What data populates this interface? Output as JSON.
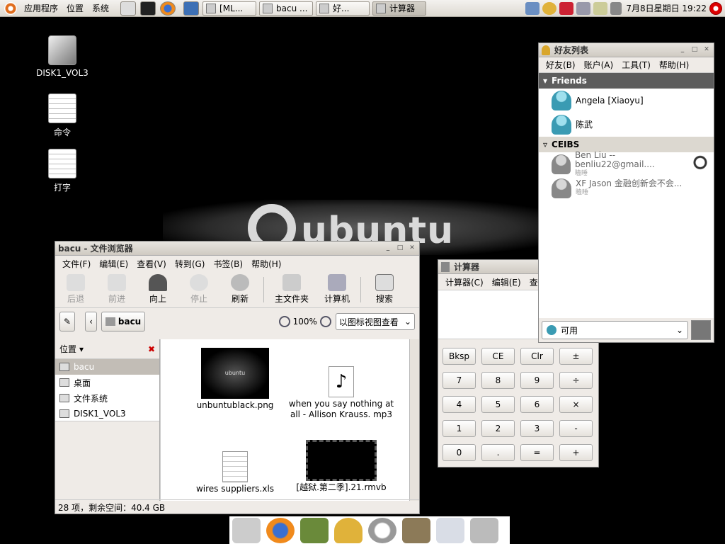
{
  "top_panel": {
    "menus": [
      "应用程序",
      "位置",
      "系统"
    ],
    "tasks": [
      "[ML...",
      "bacu ...",
      "好...",
      "计算器"
    ],
    "clock": "7月8日星期日 19:22"
  },
  "desktop": {
    "logo_text": "ubuntu",
    "icons": [
      "DISK1_VOL3",
      "命令",
      "打字"
    ]
  },
  "file_browser": {
    "title": "bacu - 文件浏览器",
    "menus": [
      "文件(F)",
      "编辑(E)",
      "查看(V)",
      "转到(G)",
      "书签(B)",
      "帮助(H)"
    ],
    "toolbar": [
      "后退",
      "前进",
      "向上",
      "停止",
      "刷新",
      "主文件夹",
      "计算机",
      "搜索"
    ],
    "location": "bacu",
    "zoom": "100%",
    "view_mode": "以图标视图查看",
    "sidebar_header": "位置",
    "places": [
      "bacu",
      "桌面",
      "文件系统",
      "DISK1_VOL3"
    ],
    "files": [
      "unbuntublack.png",
      "when you say nothing at all - Allison Krauss. mp3",
      "wires suppliers.xls",
      "[越狱.第二季].21.rmvb"
    ],
    "thumb_text": "ubuntu",
    "status": "28 项，剩余空间：40.4 GB"
  },
  "calculator": {
    "title": "计算器",
    "menus": [
      "计算器(C)",
      "编辑(E)",
      "查看"
    ],
    "keys": [
      "Bksp",
      "CE",
      "Clr",
      "±",
      "7",
      "8",
      "9",
      "÷",
      "4",
      "5",
      "6",
      "×",
      "1",
      "2",
      "3",
      "-",
      "0",
      ".",
      "=",
      "+"
    ]
  },
  "buddy_list": {
    "title": "好友列表",
    "menus": [
      "好友(B)",
      "账户(A)",
      "工具(T)",
      "帮助(H)"
    ],
    "groups": [
      {
        "name": "Friends",
        "buddies": [
          {
            "name": "Angela [Xiaoyu]",
            "status": ""
          },
          {
            "name": "陈武",
            "status": ""
          }
        ]
      },
      {
        "name": "CEIBS",
        "buddies": [
          {
            "name": "Ben Liu  -- benliu22@gmail....",
            "status": "瞌睡"
          },
          {
            "name": "XF Jason 金融创新会不会...",
            "status": "瞌睡"
          }
        ]
      }
    ],
    "status_value": "可用"
  }
}
